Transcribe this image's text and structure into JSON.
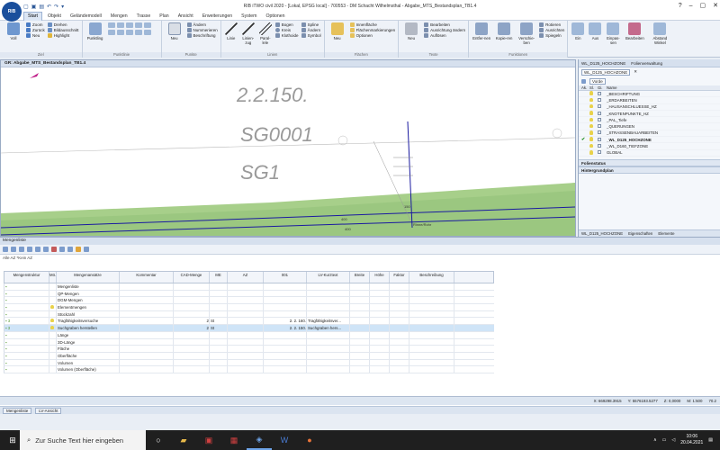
{
  "app": {
    "title": "RIB iTWO civil 2020 - [Lokal, EPSG local] - 700553 - DM Schacht Wilhelmsthal - Abgabe_MTS_Bestandsplan_TB1.4",
    "logo": "RIB"
  },
  "menu": {
    "tabs": [
      "Start",
      "Objekt",
      "Geländemodell",
      "Mengen",
      "Trasse",
      "Plan",
      "Ansicht",
      "Erweiterungen",
      "System",
      "Optionen"
    ]
  },
  "ribbon": {
    "groups": [
      {
        "label": "Ziel",
        "big": [
          "Voll"
        ],
        "items": [
          "Zoom",
          "Zurück",
          "Neu"
        ]
      },
      {
        "label": "",
        "big": [],
        "items": [
          "Drehen",
          "Bildausschnitt",
          "Highlight"
        ]
      },
      {
        "label": "Punktlinie",
        "big": [
          "Punktling"
        ],
        "items": []
      },
      {
        "label": "Punkte",
        "big": [
          "Neu"
        ],
        "items": [
          "Ändern",
          "Nummerieren",
          "Beschriftung"
        ]
      },
      {
        "label": "Linien",
        "big": [
          "Linie",
          "Linien-zug",
          "Paral-lele"
        ],
        "items": [
          "Bogen",
          "Kreis",
          "Klothoide"
        ]
      },
      {
        "label": "",
        "big": [],
        "items": [
          "Spline",
          "Ändern",
          "Symbol"
        ]
      },
      {
        "label": "Flächen",
        "big": [
          "Neu"
        ],
        "items": [
          "Innenfläche",
          "Flächenmarkierungen",
          "Optionen"
        ]
      },
      {
        "label": "Texte",
        "big": [
          "Neu"
        ],
        "items": [
          "Bearbeiten",
          "Ausrichtung ändern",
          "Auflösen"
        ]
      },
      {
        "label": "Funktionen",
        "big": [
          "Entfer-nen",
          "Kopie-ren",
          "Verschie-ben"
        ],
        "items": [
          "Rotieren",
          "Ausrichten",
          "Spiegeln"
        ]
      },
      {
        "label": "",
        "big": [
          "Ein",
          "Aus",
          "Einpas-sen",
          "Bearbeiten",
          "Abstand Winkel"
        ],
        "items": []
      }
    ]
  },
  "viewport": {
    "title": "GR: Abgabe_MTS_Bestandsplan_TB1.4",
    "labels": [
      "2.2.150.",
      "SG0001",
      "SG1"
    ],
    "small_labels": [
      "400",
      "400",
      "150",
      "Rinne/Rohr"
    ]
  },
  "layers": {
    "tabs": [
      "WL_D125_HOCHZONE",
      "Folienverwaltung"
    ],
    "current_combo": "WL_D125_HOCHZONE",
    "filter_combo": "Vorde",
    "columns": [
      "Ak.",
      "Sl.",
      "Gi.",
      "Name"
    ],
    "rows": [
      {
        "name": "_BESCHRIFTUNG",
        "active": false,
        "bold": false
      },
      {
        "name": "_ERDARBEITEN",
        "active": false,
        "bold": false
      },
      {
        "name": "_HAUSANSCHLUESSE_HZ",
        "active": false,
        "bold": false
      },
      {
        "name": "_KNOTENPUNKTE_HZ",
        "active": false,
        "bold": false
      },
      {
        "name": "_PAL_Tiefe",
        "active": false,
        "bold": false
      },
      {
        "name": "_QUERUNGEN",
        "active": false,
        "bold": false
      },
      {
        "name": "_STRASSENBAUARBEITEN",
        "active": false,
        "bold": false
      },
      {
        "name": "_WL_D125_HOCHZONE",
        "active": true,
        "bold": true
      },
      {
        "name": "_WL_D160_TIEFZONE",
        "active": false,
        "bold": false
      },
      {
        "name": "GLOBAL",
        "active": false,
        "bold": false
      }
    ],
    "sections": [
      "Folienstatus",
      "Hintergrundplan"
    ],
    "footer_tabs": [
      "WL_D125_HOCHZONE",
      "Eigenschaften",
      "Elemente"
    ]
  },
  "quantities": {
    "title": "Mengenliste",
    "filter": "Alle AZ   *Kein AZ",
    "columns": [
      "Mengenstruktur",
      "Mö.",
      "Mengenansätze",
      "Kommentar",
      "CAD-Menge",
      "ME",
      "AZ",
      "001",
      "LV-Kurztext",
      "Breite",
      "Höhe",
      "Faktor",
      "Beschreibung"
    ],
    "rows": [
      {
        "tree": "",
        "lamp": false,
        "name": "Mengenliste",
        "cad": "",
        "me": "",
        "az": "",
        "pos": "",
        "lv": "",
        "sel": false
      },
      {
        "tree": "",
        "lamp": false,
        "name": "QP-Mengen",
        "cad": "",
        "me": "",
        "az": "",
        "pos": "",
        "lv": "",
        "sel": false
      },
      {
        "tree": "",
        "lamp": false,
        "name": "DGM-Mengen",
        "cad": "",
        "me": "",
        "az": "",
        "pos": "",
        "lv": "",
        "sel": false
      },
      {
        "tree": "",
        "lamp": true,
        "name": "Elementmengen",
        "cad": "",
        "me": "",
        "az": "",
        "pos": "",
        "lv": "",
        "sel": false
      },
      {
        "tree": "",
        "lamp": false,
        "name": "Stückzahl",
        "cad": "",
        "me": "",
        "az": "",
        "pos": "",
        "lv": "",
        "sel": false
      },
      {
        "tree": "3",
        "lamp": true,
        "name": "Tragfähigkeitsversuche",
        "cad": "2",
        "me": "St",
        "az": "",
        "pos": "2. 2. 160.",
        "lv": "Tragfähigkeitsver...",
        "sel": false
      },
      {
        "tree": "3",
        "lamp": true,
        "name": "Suchgraben herstellen",
        "cad": "2",
        "me": "St",
        "az": "",
        "pos": "2. 2. 150.",
        "lv": "Suchgraben hers...",
        "sel": true
      },
      {
        "tree": "",
        "lamp": false,
        "name": "Länge",
        "cad": "",
        "me": "",
        "az": "",
        "pos": "",
        "lv": "",
        "sel": false
      },
      {
        "tree": "",
        "lamp": false,
        "name": "3D-Länge",
        "cad": "",
        "me": "",
        "az": "",
        "pos": "",
        "lv": "",
        "sel": false
      },
      {
        "tree": "",
        "lamp": false,
        "name": "Fläche",
        "cad": "",
        "me": "",
        "az": "",
        "pos": "",
        "lv": "",
        "sel": false
      },
      {
        "tree": "",
        "lamp": false,
        "name": "Oberfläche",
        "cad": "",
        "me": "",
        "az": "",
        "pos": "",
        "lv": "",
        "sel": false
      },
      {
        "tree": "",
        "lamp": false,
        "name": "Volumen",
        "cad": "",
        "me": "",
        "az": "",
        "pos": "",
        "lv": "",
        "sel": false
      },
      {
        "tree": "",
        "lamp": false,
        "name": "Volumen (Oberfläche)",
        "cad": "",
        "me": "",
        "az": "",
        "pos": "",
        "lv": "",
        "sel": false
      }
    ],
    "bottom_tabs": [
      "Mengenliste",
      "LV-Ansicht"
    ]
  },
  "status": {
    "x": "X: 669298.3915",
    "y": "Y: 5576193.5277",
    "z": "Z: 0,0000",
    "m": "M: 1:500",
    "zoom": "70.2"
  },
  "taskbar": {
    "search_placeholder": "Zur Suche Text hier eingeben",
    "time": "10:06",
    "date": "20.04.2021"
  },
  "colors": {
    "ribbon_bg": "#eef2f8",
    "accent": "#1a4f9c",
    "ground_green": "#a7cf8a",
    "line_blue": "#1a1aa0"
  }
}
